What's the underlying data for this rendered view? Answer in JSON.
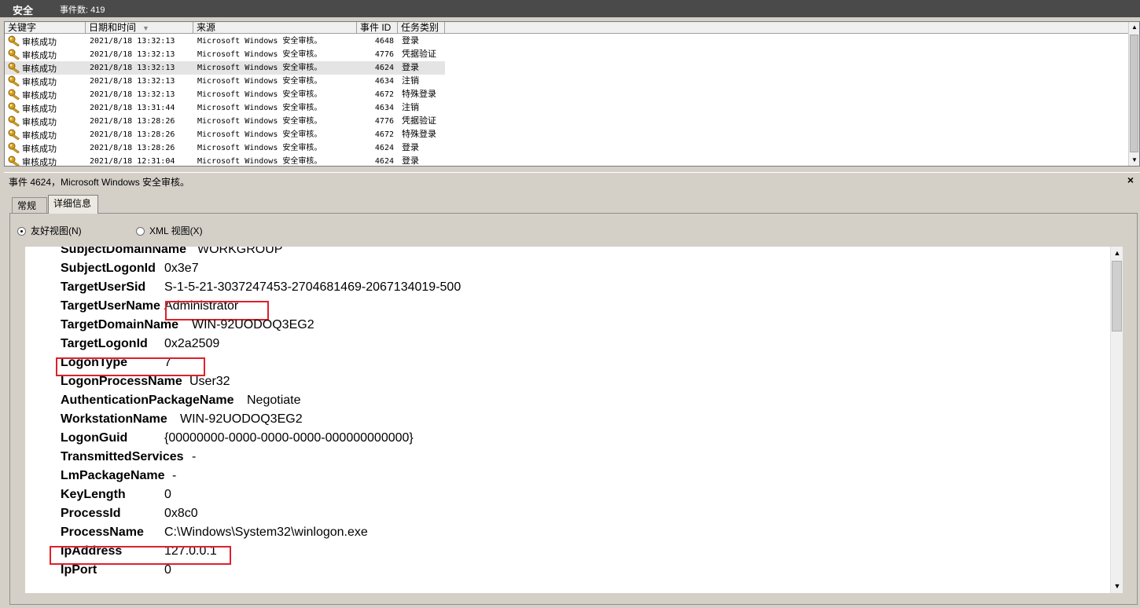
{
  "header": {
    "title": "安全",
    "count_label": "事件数: 419"
  },
  "list": {
    "columns": [
      {
        "label": "关键字"
      },
      {
        "label": "日期和时间"
      },
      {
        "label": "来源"
      },
      {
        "label": "事件 ID"
      },
      {
        "label": "任务类别"
      }
    ],
    "rows": [
      {
        "keyword": "审核成功",
        "datetime": "2021/8/18 13:32:13",
        "source": "Microsoft Windows 安全审核。",
        "id": "4648",
        "task": "登录",
        "selected": false
      },
      {
        "keyword": "审核成功",
        "datetime": "2021/8/18 13:32:13",
        "source": "Microsoft Windows 安全审核。",
        "id": "4776",
        "task": "凭据验证",
        "selected": false
      },
      {
        "keyword": "审核成功",
        "datetime": "2021/8/18 13:32:13",
        "source": "Microsoft Windows 安全审核。",
        "id": "4624",
        "task": "登录",
        "selected": true
      },
      {
        "keyword": "审核成功",
        "datetime": "2021/8/18 13:32:13",
        "source": "Microsoft Windows 安全审核。",
        "id": "4634",
        "task": "注销",
        "selected": false
      },
      {
        "keyword": "审核成功",
        "datetime": "2021/8/18 13:32:13",
        "source": "Microsoft Windows 安全审核。",
        "id": "4672",
        "task": "特殊登录",
        "selected": false
      },
      {
        "keyword": "审核成功",
        "datetime": "2021/8/18 13:31:44",
        "source": "Microsoft Windows 安全审核。",
        "id": "4634",
        "task": "注销",
        "selected": false
      },
      {
        "keyword": "审核成功",
        "datetime": "2021/8/18 13:28:26",
        "source": "Microsoft Windows 安全审核。",
        "id": "4776",
        "task": "凭据验证",
        "selected": false
      },
      {
        "keyword": "审核成功",
        "datetime": "2021/8/18 13:28:26",
        "source": "Microsoft Windows 安全审核。",
        "id": "4672",
        "task": "特殊登录",
        "selected": false
      },
      {
        "keyword": "审核成功",
        "datetime": "2021/8/18 13:28:26",
        "source": "Microsoft Windows 安全审核。",
        "id": "4624",
        "task": "登录",
        "selected": false
      },
      {
        "keyword": "审核成功",
        "datetime": "2021/8/18 12:31:04",
        "source": "Microsoft Windows 安全审核。",
        "id": "4624",
        "task": "登录",
        "selected": false
      }
    ]
  },
  "detail": {
    "header_text": "事件 4624，Microsoft Windows 安全审核。",
    "close_glyph": "×",
    "tabs": [
      {
        "label": "常规"
      },
      {
        "label": "详细信息"
      }
    ],
    "active_tab": "详细信息",
    "view_options": [
      {
        "label": "友好视图(N)",
        "selected": true
      },
      {
        "label": "XML 视图(X)",
        "selected": false
      }
    ],
    "fields": [
      {
        "name": "SubjectDomainName",
        "value": "WORKGROUP"
      },
      {
        "name": "SubjectLogonId",
        "value": "0x3e7"
      },
      {
        "name": "TargetUserSid",
        "value": "S-1-5-21-3037247453-2704681469-2067134019-500"
      },
      {
        "name": "TargetUserName",
        "value": "Administrator",
        "highlighted": "value"
      },
      {
        "name": "TargetDomainName",
        "value": "WIN-92UODOQ3EG2"
      },
      {
        "name": "TargetLogonId",
        "value": "0x2a2509"
      },
      {
        "name": "LogonType",
        "value": "7",
        "highlighted": "row"
      },
      {
        "name": "LogonProcessName",
        "value": "User32"
      },
      {
        "name": "AuthenticationPackageName",
        "value": "Negotiate"
      },
      {
        "name": "WorkstationName",
        "value": "WIN-92UODOQ3EG2"
      },
      {
        "name": "LogonGuid",
        "value": "{00000000-0000-0000-0000-000000000000}"
      },
      {
        "name": "TransmittedServices",
        "value": "-"
      },
      {
        "name": "LmPackageName",
        "value": "-"
      },
      {
        "name": "KeyLength",
        "value": "0"
      },
      {
        "name": "ProcessId",
        "value": "0x8c0"
      },
      {
        "name": "ProcessName",
        "value": "C:\\Windows\\System32\\winlogon.exe"
      },
      {
        "name": "IpAddress",
        "value": "127.0.0.1",
        "highlighted": "row"
      },
      {
        "name": "IpPort",
        "value": "0"
      }
    ]
  },
  "colors": {
    "topbar_bg": "#4a4a4a",
    "highlight_box": "#e0202a",
    "selected_row_bg": "#e4e4e4",
    "key_icon": "#d9a21b"
  },
  "icons": {
    "row_icon": "key-icon",
    "sort_indicator": "sort-down-icon"
  }
}
